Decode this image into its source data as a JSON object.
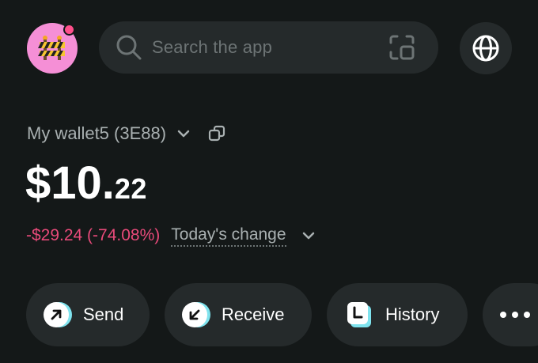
{
  "header": {
    "avatar": {
      "icon": "construction-barrier-icon",
      "notification_dot": true
    },
    "search": {
      "placeholder": "Search the app",
      "icon": "search-icon",
      "scan_icon": "scan-icon"
    },
    "globe_icon": "globe-icon"
  },
  "wallet": {
    "name": "My wallet5 (3E88)",
    "balance_major": "$10.",
    "balance_minor": "22",
    "change_value": "-$29.24 (-74.08%)",
    "change_label": "Today's change"
  },
  "actions": [
    {
      "label": "Send",
      "icon": "send-arrow-icon"
    },
    {
      "label": "Receive",
      "icon": "receive-arrow-icon"
    },
    {
      "label": "History",
      "icon": "history-icon"
    },
    {
      "label": "",
      "icon": "more-icon"
    }
  ],
  "colors": {
    "background": "#141818",
    "surface": "#252a2b",
    "negative": "#e94a7a",
    "accent": "#7fe3ee",
    "avatar_bg": "#f58fd6"
  }
}
